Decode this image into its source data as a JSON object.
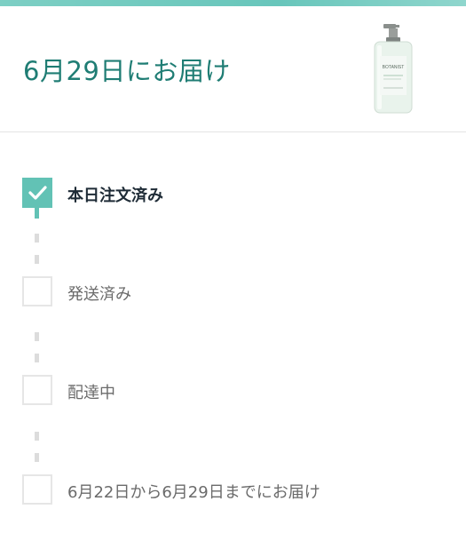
{
  "header": {
    "delivery_title": "6月29日にお届け",
    "product_image_icon": "shampoo-bottle-icon",
    "product_brand_text": "BOTANIST"
  },
  "colors": {
    "accent": "#62c2b5",
    "title_text": "#1f7d74",
    "inactive_border": "#e6e6e6"
  },
  "timeline": {
    "steps": [
      {
        "label": "本日注文済み",
        "checked": true
      },
      {
        "label": "発送済み",
        "checked": false
      },
      {
        "label": "配達中",
        "checked": false
      },
      {
        "label": "6月22日から6月29日までにお届け",
        "checked": false
      }
    ]
  }
}
